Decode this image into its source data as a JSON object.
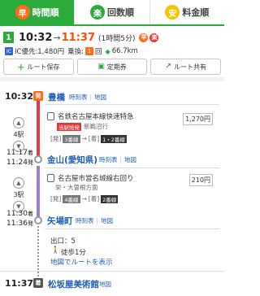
{
  "tabs": [
    {
      "icon": "早",
      "label": "時間順"
    },
    {
      "icon": "楽",
      "label": "回数順"
    },
    {
      "icon": "安",
      "label": "料金順"
    }
  ],
  "summary": {
    "route_no": "1",
    "depart": "10:32",
    "arrow": "→",
    "arrive": "11:37",
    "duration": "(1時間5分)",
    "badge1": "早",
    "badge2": "楽"
  },
  "fare_info": {
    "ic_label": "IC",
    "fare_text": "IC優先:1,480円",
    "transfer_text": "乗換:",
    "transfer_count": "1",
    "transfer_unit": "回",
    "distance": "66.7km"
  },
  "actions": {
    "save": "ルート保存",
    "pass": "定期券",
    "share": "ルート共有"
  },
  "colors": {
    "meitetsu": "#e5374d",
    "subway": "#9b7fc7",
    "accent": "#ff6b1a",
    "green": "#2bab3a"
  },
  "route": {
    "stations": [
      {
        "time": "10:32",
        "badge": "発",
        "name": "豊橋",
        "links": [
          "時刻表",
          "地図"
        ]
      },
      {
        "time_arr": "11:17",
        "arr_badge": "着",
        "time_dep": "11:24",
        "dep_badge": "発",
        "name": "金山(愛知県)",
        "links": [
          "時刻表",
          "地図"
        ]
      },
      {
        "time_arr": "11:30",
        "arr_badge": "着",
        "time_dep": "11:36",
        "dep_badge": "発",
        "name": "矢場町",
        "links": [
          "時刻表",
          "地図"
        ]
      },
      {
        "time": "11:37",
        "badge": "着",
        "name": "松坂屋美術館",
        "links": [
          "地図"
        ]
      }
    ],
    "segments": [
      {
        "stops": "4駅",
        "line": "名鉄名古屋本線快速特急",
        "tag": "当駅始発",
        "direction": "新鵜沼行",
        "platform_from": "3番線",
        "platform_to": "1・2番線",
        "fare": "1,270円"
      },
      {
        "stops": "3駅",
        "line": "名古屋市営名城線右回り",
        "direction": "栄・大曽根方面",
        "platform_from": "4番線",
        "platform_to": "2番線",
        "fare": "210円"
      }
    ],
    "from_label": "[発]",
    "arrow": "→",
    "to_label": "[着]",
    "exit": "出口：5",
    "walk": "徒歩1分",
    "map_link": "地図でルートを表示"
  }
}
